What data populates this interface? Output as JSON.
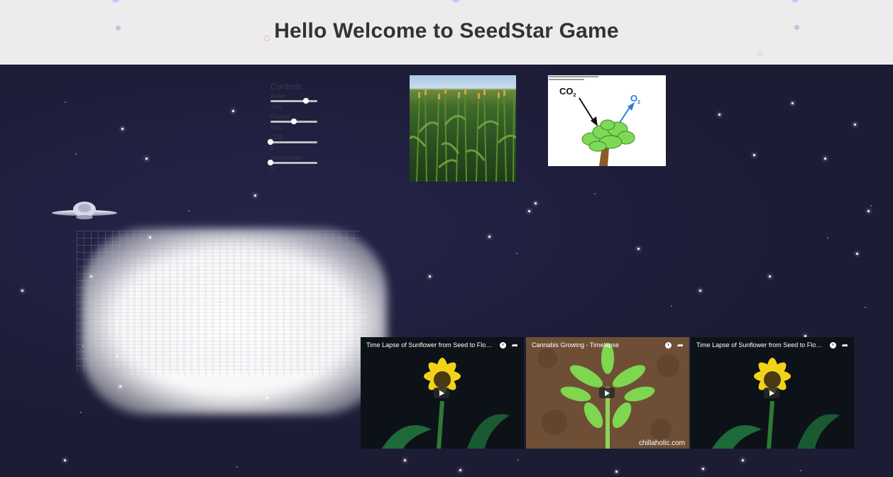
{
  "header": {
    "title": "Hello Welcome to SeedStar Game"
  },
  "controls": {
    "title": "Controls",
    "items": [
      {
        "label": "Water",
        "value": "75%",
        "level": 0.75
      },
      {
        "label": "Oxygen",
        "value": "50%",
        "level": 0.5
      },
      {
        "label": "CO2",
        "value": "0",
        "level": 0
      },
      {
        "label": "Temperature",
        "value": "0",
        "level": 0
      }
    ]
  },
  "diagram": {
    "co2_label": "CO",
    "o2_label": "O",
    "subscript": "2"
  },
  "videos": [
    {
      "title": "Time Lapse of Sunflower from Seed to Flow...",
      "subject": "sunflower"
    },
    {
      "title": "Cannabis Growing - Timelapse",
      "subject": "cannabis",
      "watermark": "chillaholic.com"
    },
    {
      "title": "Time Lapse of Sunflower from Seed to Flow...",
      "subject": "sunflower"
    }
  ],
  "colors": {
    "space": "#1c1c35",
    "header": "#ececec",
    "title": "#333333"
  }
}
